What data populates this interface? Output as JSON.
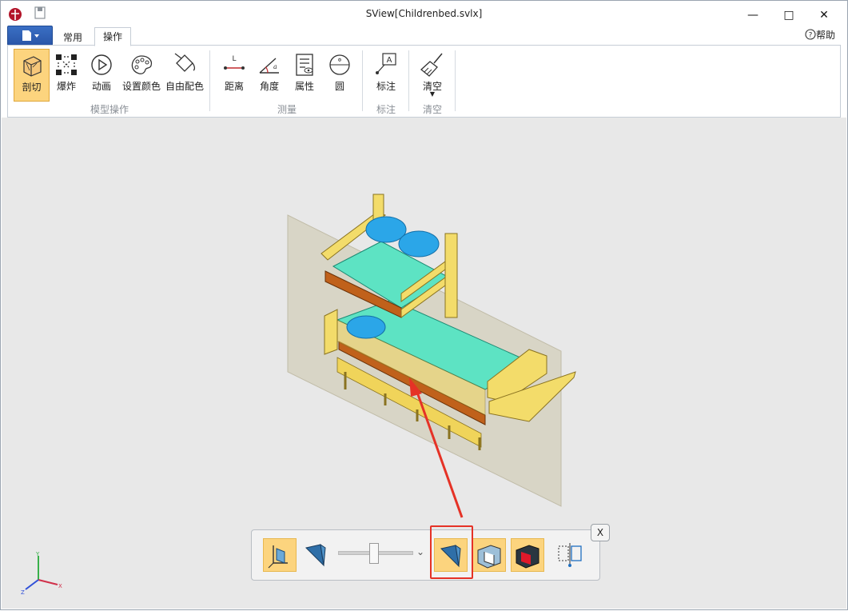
{
  "window": {
    "title": "SView[Childrenbed.svlx]",
    "minimize": "—",
    "maximize": "□",
    "close": "✕"
  },
  "tabs": [
    {
      "label": "常用"
    },
    {
      "label": "操作"
    }
  ],
  "help": {
    "label": "帮助"
  },
  "ribbon": {
    "buttons": [
      {
        "label": "剖切",
        "icon": "section-cube-icon"
      },
      {
        "label": "爆炸",
        "icon": "explode-icon"
      },
      {
        "label": "动画",
        "icon": "play-icon"
      },
      {
        "label": "设置颜色",
        "icon": "palette-icon"
      },
      {
        "label": "自由配色",
        "icon": "paint-bucket-icon"
      },
      {
        "label": "距离",
        "icon": "distance-icon"
      },
      {
        "label": "角度",
        "icon": "angle-icon"
      },
      {
        "label": "属性",
        "icon": "properties-icon"
      },
      {
        "label": "圆",
        "icon": "circle-measure-icon"
      },
      {
        "label": "标注",
        "icon": "annotation-icon"
      },
      {
        "label": "清空",
        "icon": "broom-icon"
      }
    ],
    "groups": [
      {
        "label": "模型操作"
      },
      {
        "label": "测量"
      },
      {
        "label": "标注"
      },
      {
        "label": "清空"
      }
    ]
  },
  "section_toolbar": {
    "close_label": "X",
    "dropdown": "⌄",
    "slider_value": 0.24
  },
  "colors": {
    "accent": "#fcd47e",
    "highlight": "#e53226",
    "file_button": "#2a56a8"
  }
}
